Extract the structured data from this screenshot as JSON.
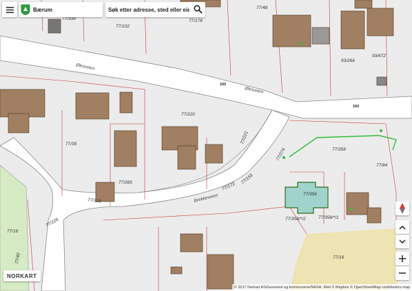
{
  "ui": {
    "municipality": "Bærum",
    "search_placeholder": "Søk etter adresse, sted eller eiendom",
    "logo": "NORKART",
    "attribution": "© 2017 Norkart AS/Geovekst og kommunene/NASA, Meti © Mapbox © OpenStreetMap contributors map"
  },
  "map": {
    "roads": [
      "Økriveien",
      "Økriveien",
      "Brekkeveien"
    ],
    "house_numbers": [
      "160",
      "160"
    ],
    "parcels": [
      "77/339",
      "77/102",
      "77/178",
      "77/48",
      "93/672",
      "93/266",
      "77/220",
      "77/39",
      "77/221",
      "77/285",
      "77/173",
      "77/155",
      "77/120",
      "77/358",
      "77/84",
      "77/274",
      "77/356",
      "77/358/*/2",
      "77/358/*/1",
      "77/16",
      "77/16",
      "77/226",
      "77/40"
    ],
    "colors": {
      "building": "#a07f62",
      "road": "#ffffff",
      "field": "#eee4b3",
      "green": "#d6ebc4",
      "parcel_line": "#cc3333",
      "new_building_fill": "#9fd3cc",
      "new_building_outline": "#2f6b1f",
      "green_line": "#33bb33"
    }
  }
}
